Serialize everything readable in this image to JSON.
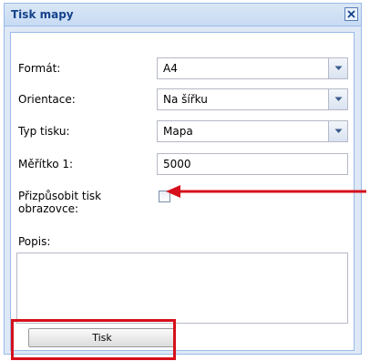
{
  "dialog": {
    "title": "Tisk mapy",
    "close_icon": "close-icon"
  },
  "form": {
    "format": {
      "label": "Formát:",
      "value": "A4"
    },
    "orientation": {
      "label": "Orientace:",
      "value": "Na šířku"
    },
    "print_type": {
      "label": "Typ tisku:",
      "value": "Mapa"
    },
    "scale": {
      "label": "Měřítko 1:",
      "value": "5000"
    },
    "fit_screen": {
      "label_line1": "Přizpůsobit tisk",
      "label_line2": "obrazovce:",
      "checked": false
    },
    "description": {
      "label": "Popis:",
      "value": ""
    }
  },
  "actions": {
    "print_label": "Tisk"
  },
  "annotations": {
    "highlight_color": "#d6101c"
  }
}
